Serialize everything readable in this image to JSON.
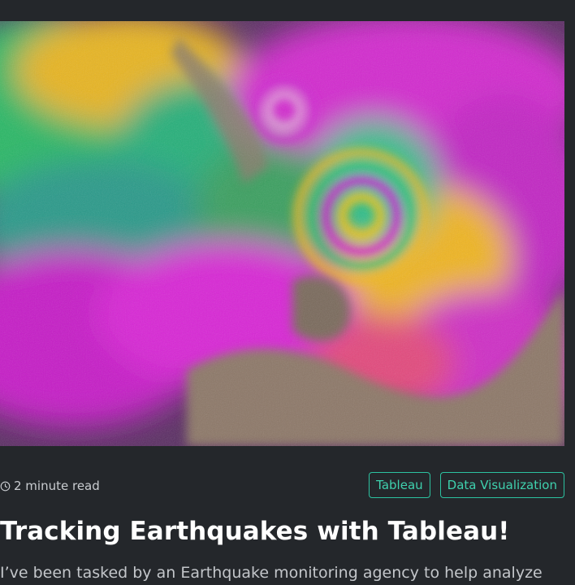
{
  "hero": {
    "image": "insar-interferogram-earthquake-map",
    "colors": [
      "#d21fd0",
      "#f0c020",
      "#28c070",
      "#e58a2a",
      "#8a7466"
    ]
  },
  "meta": {
    "read_time": "2 minute read",
    "clock_icon": "clock-icon"
  },
  "tags": [
    {
      "label": "Tableau"
    },
    {
      "label": "Data Visualization"
    }
  ],
  "post": {
    "title": "Tracking Earthquakes with Tableau!",
    "excerpt": "I’ve been tasked by an Earthquake monitoring agency to help analyze"
  },
  "colors": {
    "background": "#24272b",
    "accent": "#2cc2a0",
    "text": "#ffffff",
    "muted": "#c3c6ca"
  }
}
